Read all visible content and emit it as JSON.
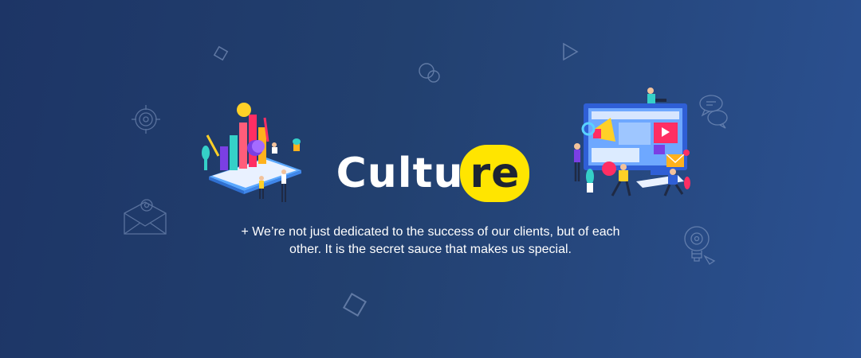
{
  "banner": {
    "title_prefix": "Cultu",
    "title_highlight": "re",
    "description_line1": "+ We’re not just dedicated to the success of our clients, but of each",
    "description_line2": "other. It is the secret sauce that makes us special."
  },
  "colors": {
    "background_start": "#1d3566",
    "background_end": "#2b5192",
    "highlight": "#ffe500",
    "text": "#ffffff"
  },
  "icons": [
    "diamond-outline-icon",
    "target-icon",
    "envelope-gear-icon",
    "circles-icon",
    "play-triangle-icon",
    "chat-bubbles-icon",
    "lightbulb-gear-icon",
    "square-outline-icon"
  ],
  "illustrations": [
    "analytics-phone-illustration",
    "marketing-team-illustration"
  ]
}
